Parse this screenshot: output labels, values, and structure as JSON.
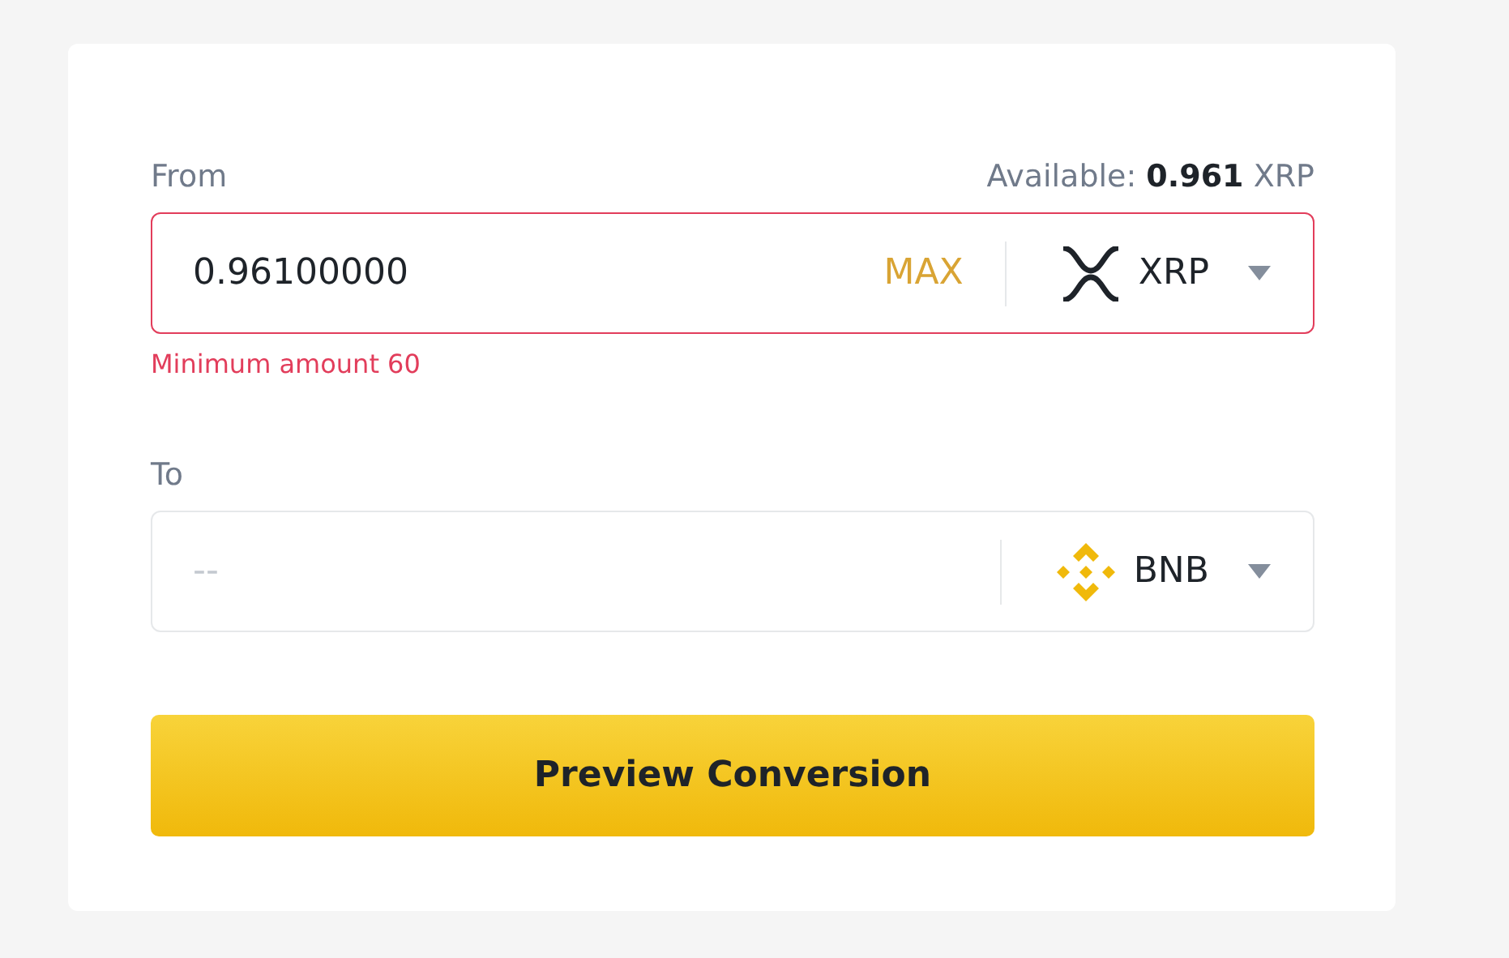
{
  "from": {
    "label": "From",
    "available": "Available: **0.961** XRP",
    "value": "0.96100000",
    "max_button": "MAX",
    "currency": "XRP",
    "invalid": true,
    "error": "Minimum amount 60"
  },
  "to": {
    "label": "To",
    "placeholder": "--",
    "currency": "BNB",
    "invalid": false
  },
  "submit_button": "Preview Conversion"
}
